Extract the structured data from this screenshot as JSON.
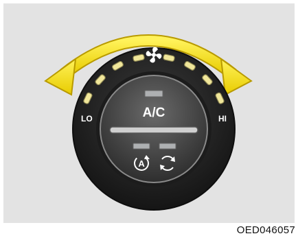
{
  "labels": {
    "lo": "LO",
    "hi": "HI",
    "ac": "A/C",
    "image_code": "OED046057"
  },
  "icons": {
    "fan": "fan-icon",
    "auto": "auto-mode-icon",
    "recirculation": "recirculation-icon"
  },
  "colors": {
    "arrow": "#f3df20",
    "arrow_outline": "#b89a00",
    "indicator": "#f0e69a",
    "knob_outer": "#2a2a2a",
    "knob_inner": "#4a4a4a",
    "background": "#e3e3e3"
  },
  "fan_speed_levels": 8
}
